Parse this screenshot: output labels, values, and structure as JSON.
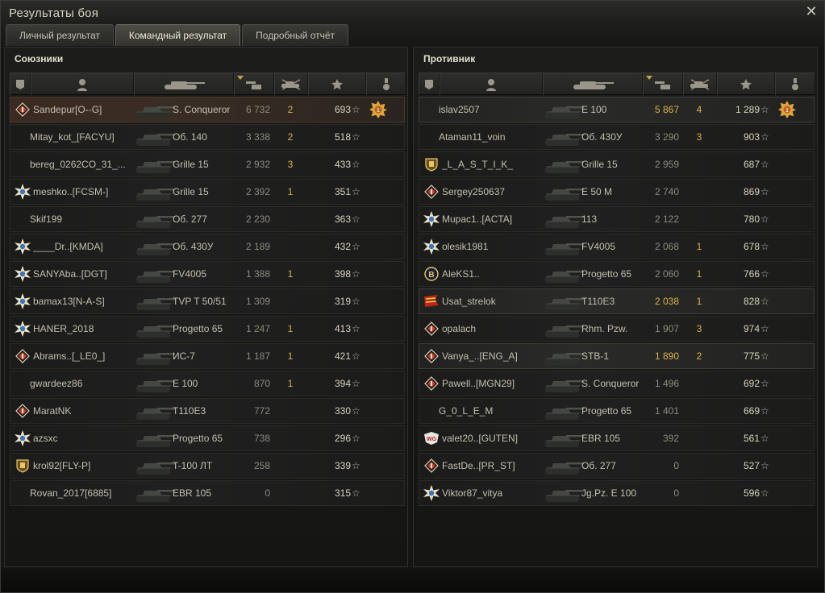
{
  "window": {
    "title": "Результаты боя",
    "close_icon": "close-icon"
  },
  "tabs": [
    {
      "label": "Личный результат",
      "active": false
    },
    {
      "label": "Командный результат",
      "active": true
    },
    {
      "label": "Подробный отчёт",
      "active": false
    }
  ],
  "allies": {
    "title": "Союзники",
    "rows": [
      {
        "name": "Sandepur[O--G]",
        "tank": "S. Conqueror",
        "damage": "6 732",
        "kills": "2",
        "xp": "693",
        "badge": "diamond",
        "medal": true,
        "self": true
      },
      {
        "name": "Mitay_kot_[FACYU]",
        "tank": "Об. 140",
        "damage": "3 338",
        "kills": "2",
        "xp": "518",
        "badge": ""
      },
      {
        "name": "bereg_0262CO_31_...",
        "tank": "Grille 15",
        "damage": "2 932",
        "kills": "3",
        "xp": "433",
        "badge": ""
      },
      {
        "name": "meshko..[FCSM-]",
        "tank": "Grille 15",
        "damage": "2 392",
        "kills": "1",
        "xp": "351",
        "badge": "star"
      },
      {
        "name": "Skif199",
        "tank": "Об. 277",
        "damage": "2 230",
        "kills": "",
        "xp": "363",
        "badge": ""
      },
      {
        "name": "____Dr..[KMDA]",
        "tank": "Об. 430У",
        "damage": "2 189",
        "kills": "",
        "xp": "432",
        "badge": "star"
      },
      {
        "name": "SANYAba..[DGT]",
        "tank": "FV4005",
        "damage": "1 388",
        "kills": "1",
        "xp": "398",
        "badge": "star"
      },
      {
        "name": "bamax13[N-A-S]",
        "tank": "TVP T 50/51",
        "damage": "1 309",
        "kills": "",
        "xp": "319",
        "badge": "star"
      },
      {
        "name": "HANER_2018",
        "tank": "Progetto 65",
        "damage": "1 247",
        "kills": "1",
        "xp": "413",
        "badge": "star"
      },
      {
        "name": "Abrams..[_LE0_]",
        "tank": "ИС-7",
        "damage": "1 187",
        "kills": "1",
        "xp": "421",
        "badge": "diamond"
      },
      {
        "name": "gwardeez86",
        "tank": "E 100",
        "damage": "870",
        "kills": "1",
        "xp": "394",
        "badge": ""
      },
      {
        "name": "MaratNK",
        "tank": "T110E3",
        "damage": "772",
        "kills": "",
        "xp": "330",
        "badge": "diamond"
      },
      {
        "name": "azsxc",
        "tank": "Progetto 65",
        "damage": "738",
        "kills": "",
        "xp": "296",
        "badge": "star"
      },
      {
        "name": "krol92[FLY-P]",
        "tank": "T-100 ЛТ",
        "damage": "258",
        "kills": "",
        "xp": "339",
        "badge": "shield"
      },
      {
        "name": "Rovan_2017[6885]",
        "tank": "EBR 105",
        "damage": "0",
        "kills": "",
        "xp": "315",
        "badge": ""
      }
    ]
  },
  "enemies": {
    "title": "Противник",
    "rows": [
      {
        "name": "islav2507",
        "tank": "E 100",
        "damage": "5 867",
        "kills": "4",
        "xp": "1 289",
        "badge": "",
        "medal": true,
        "top": true,
        "gold": true
      },
      {
        "name": "Ataman11_voin",
        "tank": "Об. 430У",
        "damage": "3 290",
        "kills": "3",
        "xp": "903",
        "badge": ""
      },
      {
        "name": "_L_A_S_T_I_K_",
        "tank": "Grille 15",
        "damage": "2 959",
        "kills": "",
        "xp": "687",
        "badge": "shield"
      },
      {
        "name": "Sergey250637",
        "tank": "E 50 M",
        "damage": "2 740",
        "kills": "",
        "xp": "869",
        "badge": "diamond"
      },
      {
        "name": "Mupac1..[ACTA]",
        "tank": "113",
        "damage": "2 122",
        "kills": "",
        "xp": "780",
        "badge": "star"
      },
      {
        "name": "olesik1981",
        "tank": "FV4005",
        "damage": "2 068",
        "kills": "1",
        "xp": "678",
        "badge": "star"
      },
      {
        "name": "AleKS1..",
        "tank": "Progetto 65",
        "damage": "2 060",
        "kills": "1",
        "xp": "766",
        "badge": "b"
      },
      {
        "name": "Usat_strelok",
        "tank": "T110E3",
        "damage": "2 038",
        "kills": "1",
        "xp": "828",
        "badge": "flag",
        "top": true,
        "gold": true
      },
      {
        "name": "opalach",
        "tank": "Rhm. Pzw.",
        "damage": "1 907",
        "kills": "3",
        "xp": "974",
        "badge": "diamond"
      },
      {
        "name": "Vanya_..[ENG_A]",
        "tank": "STB-1",
        "damage": "1 890",
        "kills": "2",
        "xp": "775",
        "badge": "diamond",
        "top": true,
        "gold": true
      },
      {
        "name": "Pawell..[MGN29]",
        "tank": "S. Conqueror",
        "damage": "1 496",
        "kills": "",
        "xp": "692",
        "badge": "diamond"
      },
      {
        "name": "G_0_L_E_M",
        "tank": "Progetto 65",
        "damage": "1 401",
        "kills": "",
        "xp": "669",
        "badge": ""
      },
      {
        "name": "valet20..[GUTEN]",
        "tank": "EBR 105",
        "damage": "392",
        "kills": "",
        "xp": "561",
        "badge": "wg"
      },
      {
        "name": "FastDe..[PR_ST]",
        "tank": "Об. 277",
        "damage": "0",
        "kills": "",
        "xp": "527",
        "badge": "diamond"
      },
      {
        "name": "Viktor87_vitya",
        "tank": "Jg.Pz. E 100",
        "damage": "0",
        "kills": "",
        "xp": "596",
        "badge": "star"
      }
    ]
  },
  "colors": {
    "gold": "#d9b24a",
    "dim": "#8e8a7f",
    "text": "#c4bfae"
  },
  "icons": {
    "headers": [
      "platoon-icon",
      "player-icon",
      "tank-icon",
      "damage-icon",
      "kills-icon",
      "xp-star-icon",
      "medal-icon"
    ]
  }
}
